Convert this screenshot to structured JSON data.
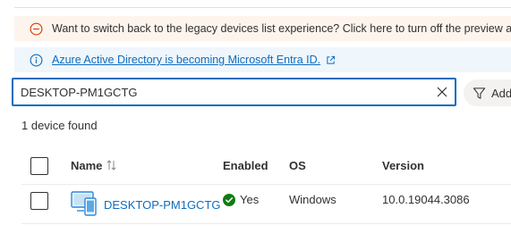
{
  "banners": {
    "legacy": {
      "text": "Want to switch back to the legacy devices list experience? Click here to turn off the preview and re",
      "icon": "warning-circle-icon",
      "color": "#d83b01"
    },
    "entra": {
      "link_text": "Azure Active Directory is becoming Microsoft Entra ID.",
      "icon": "info-circle-icon",
      "color": "#0f6cbd"
    }
  },
  "search": {
    "value": "DESKTOP-PM1GCTG",
    "clear_icon": "close-icon"
  },
  "filter_button": {
    "label": "Add",
    "icon": "filter-icon"
  },
  "results": {
    "count_text": "1 device found"
  },
  "table": {
    "columns": [
      {
        "label": "Name",
        "sortable": true
      },
      {
        "label": "Enabled"
      },
      {
        "label": "OS"
      },
      {
        "label": "Version"
      }
    ],
    "rows": [
      {
        "name": "DESKTOP-PM1GCTG",
        "enabled": "Yes",
        "os": "Windows",
        "version": "10.0.19044.3086"
      }
    ]
  },
  "colors": {
    "accent": "#0f6cbd",
    "success": "#107c10",
    "warning_bg": "#fdf4ed",
    "info_bg": "#eff6fc"
  }
}
